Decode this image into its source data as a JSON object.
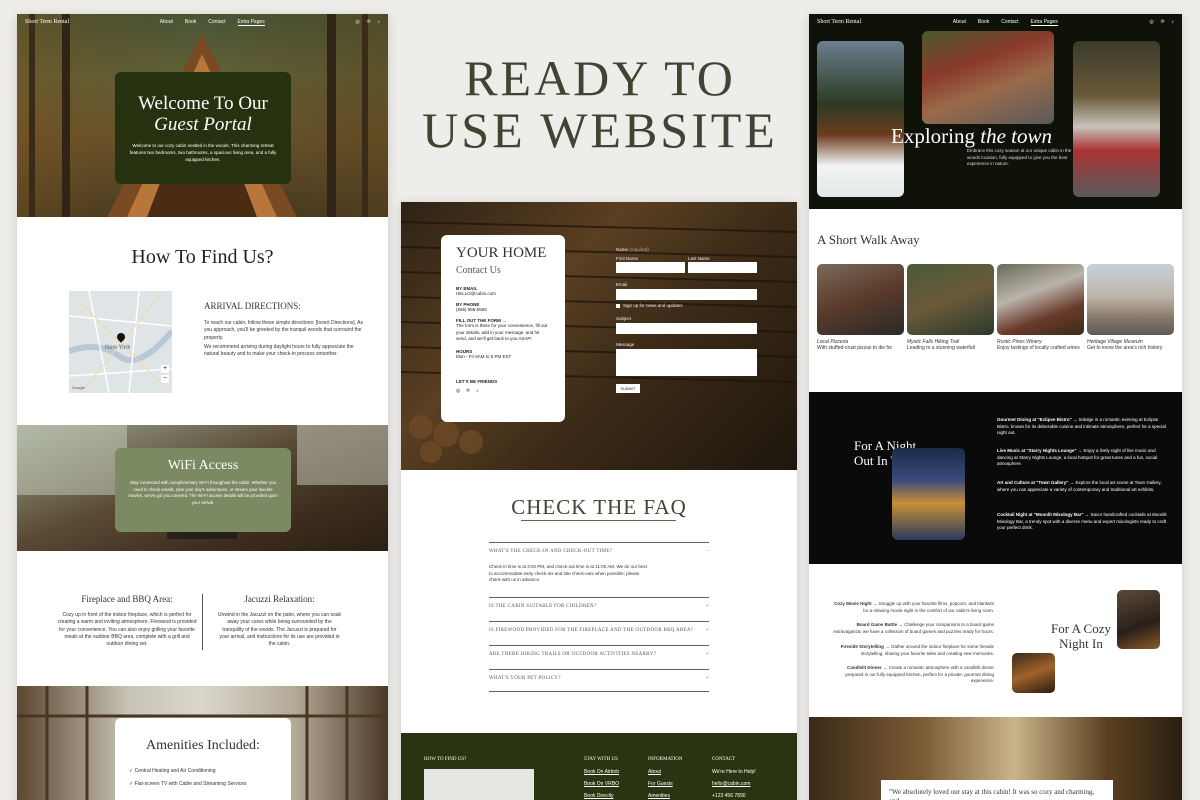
{
  "headline": {
    "line1": "READY TO",
    "line2": "USE WEBSITE"
  },
  "left": {
    "nav": {
      "brand": "Short Term Rental",
      "links": [
        "About",
        "Book",
        "Contact",
        "Extra Pages"
      ],
      "active": "Extra Pages",
      "social": [
        "instagram-icon",
        "pinterest-icon",
        "tiktok-icon"
      ]
    },
    "hero": {
      "title_line1": "Welcome To Our",
      "title_line2": "Guest Portal",
      "body": "Welcome to our cozy cabin nestled in the woods. This charming retreat features two bedrooms, two bathrooms, a spacious living area, and a fully equipped kitchen."
    },
    "find": {
      "title": "How To Find Us?",
      "map_city": "New York",
      "map_google": "Google",
      "map_zoom_in": "+",
      "map_zoom_out": "−",
      "arrival_title": "ARRIVAL DIRECTIONS:",
      "p1": "To reach our cabin, follow these simple directions: [Insert Directions]. As you approach, you'll be greeted by the tranquil woods that surround the property.",
      "p2": "We recommend arriving during daylight hours to fully appreciate the natural beauty and to make your check-in process smoother."
    },
    "wifi": {
      "title": "WiFi Access",
      "body": "Stay connected with complimentary Wi-Fi throughout the cabin. Whether you need to check emails, plan your day's adventures, or stream your favorite movies, we've got you covered. The Wi-Fi access details will be provided upon your arrival."
    },
    "fireplace": {
      "title": "Fireplace and BBQ Area:",
      "body": "Cozy up in front of the indoor fireplace, which is perfect for creating a warm and inviting atmosphere. Firewood is provided for your convenience. You can also enjoy grilling your favorite meals at the outdoor BBQ area, complete with a grill and outdoor dining set."
    },
    "jacuzzi": {
      "title": "Jacuzzi Relaxation:",
      "body": "Unwind in the Jacuzzi on the patio, where you can soak away your cares while being surrounded by the tranquility of the woods. The Jacuzzi is prepared for your arrival, and instructions for its use are provided in the cabin."
    },
    "amenities": {
      "title": "Amenities Included:",
      "items": [
        "Central Heating and Air Conditioning",
        "Flat-screen TV with Cable and Streaming Services"
      ]
    }
  },
  "middle": {
    "contact": {
      "title": "YOUR HOME",
      "subtitle": "Contact Us",
      "email_label": "BY EMAIL",
      "email": "HELLO@cabin.com",
      "phone_label": "BY PHONE",
      "phone": "(555) 555-5555",
      "form_label": "FILL OUT THE FORM →",
      "form_body": "The form is there for your convenience, fill out your details, add in your message, and hit send, and we'll get back to you ASAP!",
      "hours_label": "HOURS",
      "hours": "Mon - Fri 8AM to 5 PM EST",
      "friends": "LET'S BE FRIENDS"
    },
    "form": {
      "name": "Name",
      "required": "(required)",
      "first": "First Name",
      "last": "Last Name",
      "email": "Email",
      "signup": "Sign up for news and updates",
      "subject": "Subject",
      "message": "Message",
      "submit": "SUBMIT"
    },
    "faq": {
      "title": "CHECK THE FAQ",
      "q1": "WHAT'S THE CHECK-IN AND CHECK-OUT TIME?",
      "a1": "Check-in time is at 3:00 PM, and check-out time is at 11:00 AM. We do our best to accommodate early check-ins and late check-outs when possible; please check with us in advance.",
      "q2": "IS THE CABIN SUITABLE FOR CHILDREN?",
      "q3": "IS FIREWOOD PROVIDED FOR THE FIREPLACE AND THE OUTDOOR BBQ AREA?",
      "q4": "ARE THERE HIKING TRAILS OR OUTDOOR ACTIVITIES NEARBY?",
      "q5": "WHAT'S YOUR PET POLICY?",
      "open": "−",
      "closed": "+"
    },
    "footer": {
      "find": "HOW TO FIND US?",
      "stay_title": "STAY WITH US",
      "stay": [
        "Book On Airbnb",
        "Book On VRBO",
        "Book Directly"
      ],
      "info_title": "INFORMATION",
      "info": [
        "About",
        "For Guests",
        "Amenities"
      ],
      "contact_title": "CONTACT",
      "contact": [
        "We're Here to Help!",
        "hello@cabin.com",
        "+123 456 7890"
      ]
    }
  },
  "right": {
    "nav": {
      "brand": "Short Term Rental",
      "links": [
        "About",
        "Book",
        "Contact",
        "Extra Pages"
      ],
      "active": "Extra Pages",
      "social": [
        "instagram-icon",
        "pinterest-icon",
        "tiktok-icon"
      ]
    },
    "explore": {
      "title_a": "Exploring",
      "title_b": "the town",
      "body": "Embrace this cozy season at our unique cabin in the woods location, fully equipped to give you the best experience in nature."
    },
    "walk": {
      "title": "A Short Walk Away",
      "cards": [
        {
          "name": "Local Pizzeria",
          "desc": "With stuffed-crust pizzas to die for"
        },
        {
          "name": "Mystic Falls Hiking Trail",
          "desc": "Leading to a stunning waterfall"
        },
        {
          "name": "Rustic Pines Winery",
          "desc": "Enjoy tastings of locally crafted wines"
        },
        {
          "name": "Heritage Village Museum",
          "desc": "Get to know the area's rich history"
        }
      ]
    },
    "night_out": {
      "title_line1": "For A Night",
      "title_line2": "Out In Town",
      "items": [
        {
          "name": "Gourmet Dining at \"Eclipse Bistro\"",
          "text": " → Indulge in a romantic evening at Eclipse Bistro, known for its delectable cuisine and intimate atmosphere, perfect for a special night out."
        },
        {
          "name": "Live Music at \"Starry Nights Lounge\"",
          "text": " → Enjoy a lively night of live music and dancing at Starry Nights Lounge, a local hotspot for great tunes and a fun, social atmosphere."
        },
        {
          "name": "Art and Culture at \"Town Gallery\"",
          "text": " → Explore the local art scene at Town Gallery, where you can appreciate a variety of contemporary and traditional art exhibits."
        },
        {
          "name": "Cocktail Night at \"Moonlit Mixology Bar\"",
          "text": " → Savor handcrafted cocktails at Moonlit Mixology Bar, a trendy spot with a diverse menu and expert mixologists ready to craft your perfect drink."
        }
      ]
    },
    "night_in": {
      "title_line1": "For A Cozy",
      "title_line2": "Night In",
      "items": [
        {
          "name": "Cozy Movie Night",
          "text": " → Snuggle up with your favorite films, popcorn, and blankets for a relaxing movie night in the comfort of our cabin's living room."
        },
        {
          "name": "Board Game Battle",
          "text": " → Challenge your companions to a board game extravaganza; we have a collection of board games and puzzles ready for hours."
        },
        {
          "name": "Fireside Storytelling",
          "text": " → Gather around the indoor fireplace for some fireside storytelling, sharing your favorite tales and creating new memories."
        },
        {
          "name": "Candlelit Dinner",
          "text": " → Create a romantic atmosphere with a candlelit dinner prepared in our fully equipped kitchen, perfect for a private, gourmet dining experience."
        }
      ]
    },
    "testimonial": "\"We absolutely loved our stay at this cabin! It was so cozy and charming, and"
  },
  "colors": {
    "forest": "#2b3410",
    "sage": "#7d8a63",
    "cream": "#f4f2ec",
    "dark": "#0c0c0c"
  }
}
